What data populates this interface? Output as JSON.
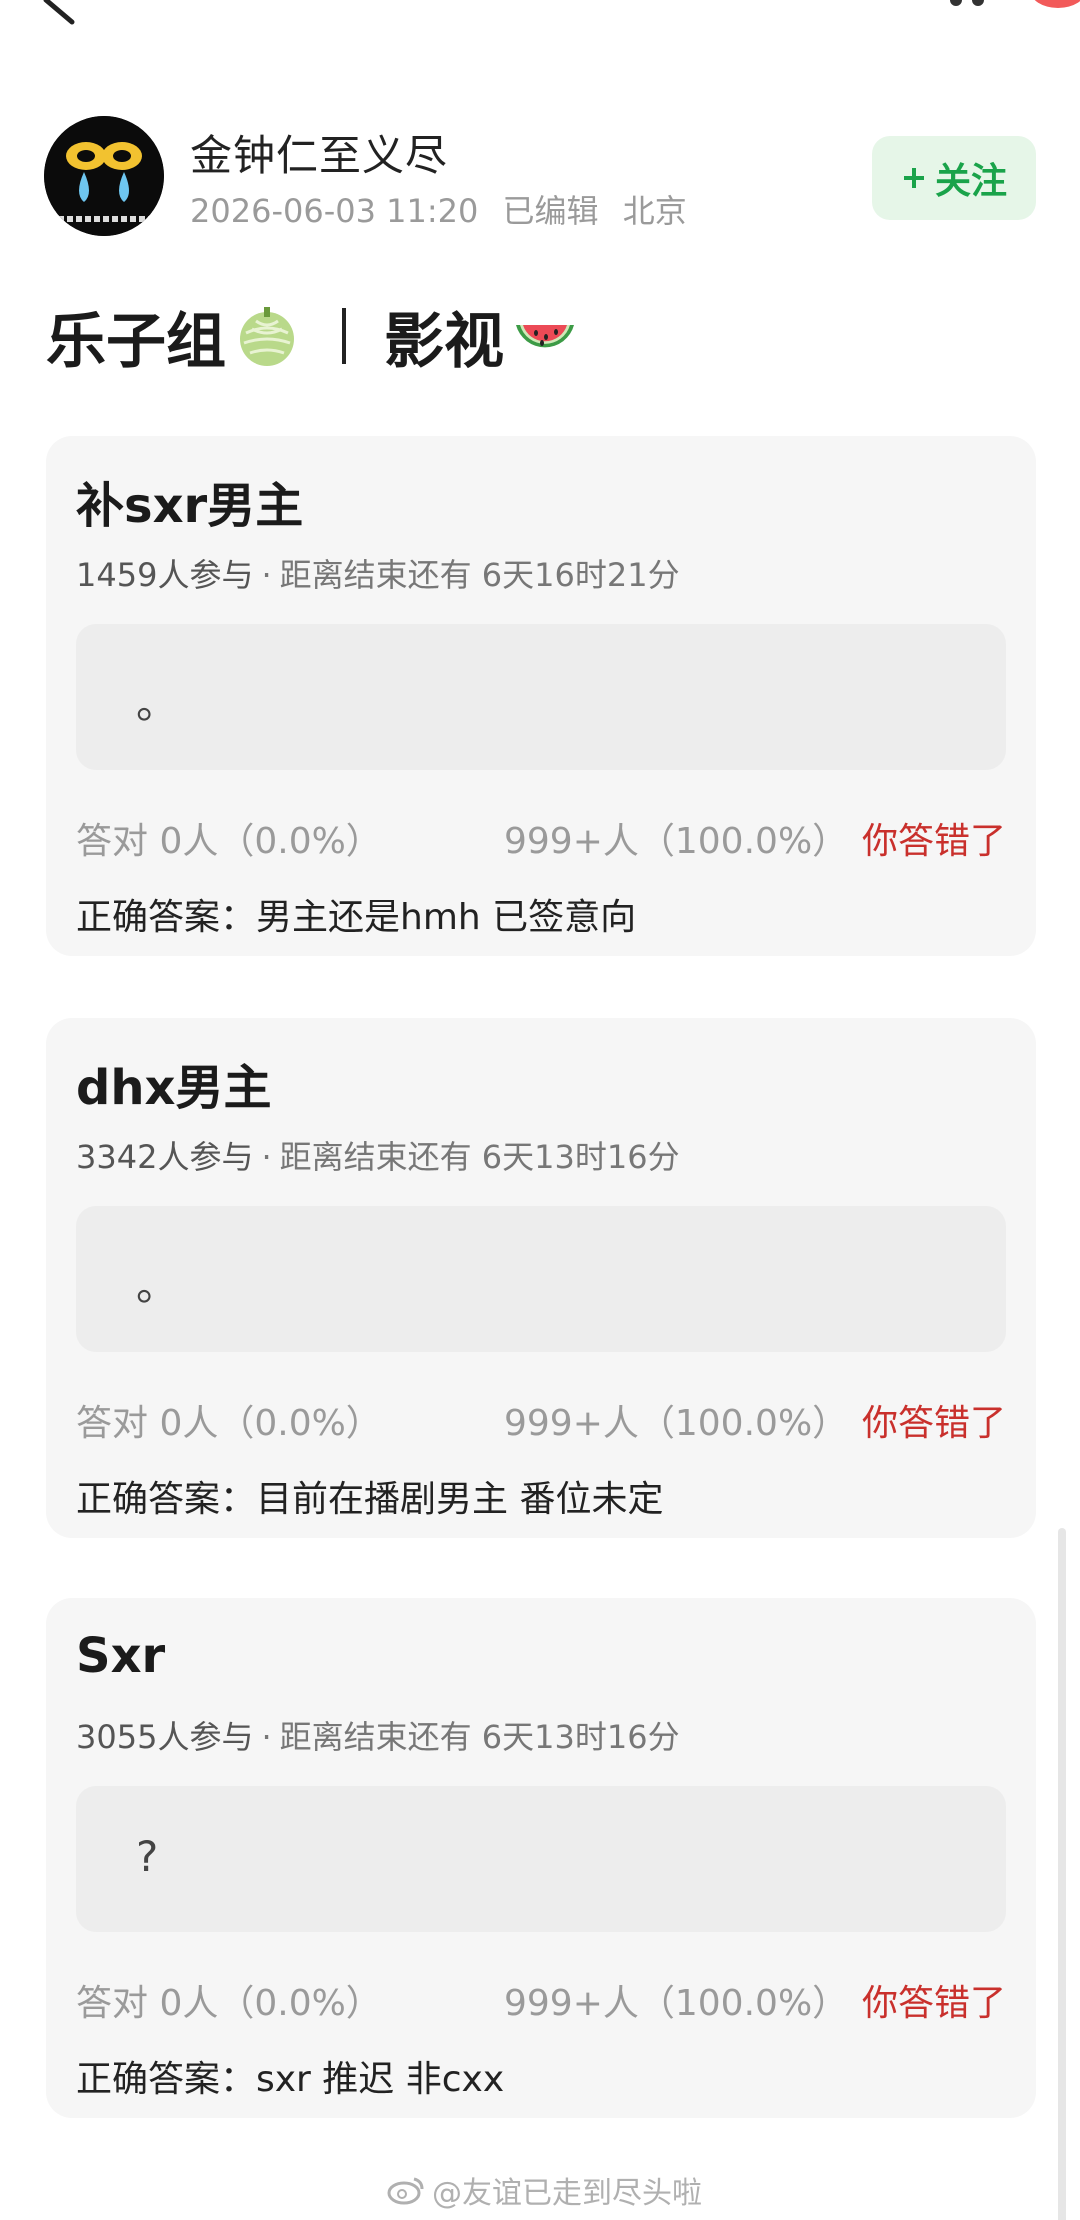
{
  "author": {
    "name": "金钟仁至义尽",
    "date": "2026-06-03 11:20",
    "edited": "已编辑",
    "location": "北京",
    "follow_label": "关注"
  },
  "post": {
    "title_part1": "乐子组",
    "title_part2": "影视"
  },
  "cards": [
    {
      "title": "补sxr男主",
      "participants": "1459人参与",
      "separator": "·",
      "time_left": "距离结束还有 6天16时21分",
      "answer": "。",
      "correct_stat": "答对  0人（0.0%）",
      "wrong_stat": "999+人（100.0%）",
      "result": "你答错了",
      "correct_answer": "正确答案：男主还是hmh 已签意向"
    },
    {
      "title": "dhx男主",
      "participants": "3342人参与",
      "separator": "·",
      "time_left": "距离结束还有 6天13时16分",
      "answer": "。",
      "correct_stat": "答对  0人（0.0%）",
      "wrong_stat": "999+人（100.0%）",
      "result": "你答错了",
      "correct_answer": "正确答案：目前在播剧男主 番位未定"
    },
    {
      "title": "Sxr",
      "participants": "3055人参与",
      "separator": "·",
      "time_left": "距离结束还有 6天13时16分",
      "answer": "?",
      "correct_stat": "答对  0人（0.0%）",
      "wrong_stat": "999+人（100.0%）",
      "result": "你答错了",
      "correct_answer": "正确答案：sxr 推迟 非cxx"
    }
  ],
  "watermark": "@友谊已走到尽头啦",
  "colors": {
    "accent_green": "#1aa34a",
    "follow_bg": "#e6f6e8",
    "wrong_red": "#c9302c",
    "card_bg": "#f6f6f6"
  },
  "icons": {
    "back": "back-arrow-icon",
    "more": "more-dots-icon",
    "title_emoji_1": "melon-emoji-icon",
    "title_emoji_2": "watermelon-emoji-icon"
  }
}
